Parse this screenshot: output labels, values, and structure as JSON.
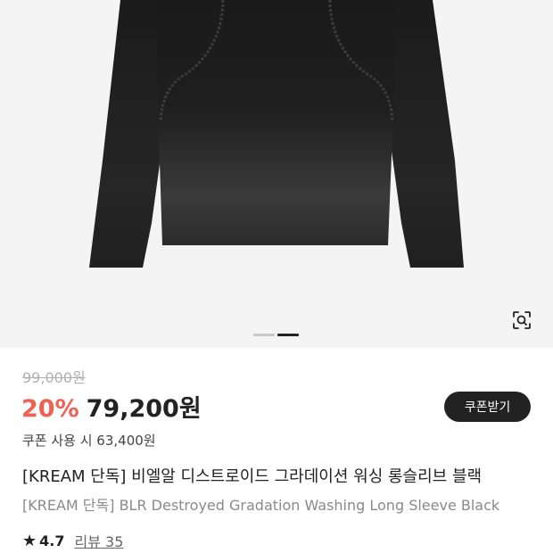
{
  "product": {
    "original_price": "99,000원",
    "discount": "20%",
    "price": "79,200원",
    "coupon_button": "쿠폰받기",
    "coupon_price_text": "쿠폰 사용 시 63,400원",
    "title_ko": "[KREAM 단독] 비엘알 디스트로이드 그라데이션 워싱 롱슬리브 블랙",
    "title_en": "[KREAM 단독] BLR Destroyed Gradation Washing Long Sleeve Black",
    "rating": "4.7",
    "review_link": "리뷰 35"
  },
  "carousel": {
    "total": 2,
    "active_index": 1
  },
  "icons": {
    "lens": "image-search-icon",
    "star": "star-icon"
  },
  "colors": {
    "discount": "#ef6253",
    "button_bg": "#222222",
    "hero_bg": "#f4f4f4"
  }
}
